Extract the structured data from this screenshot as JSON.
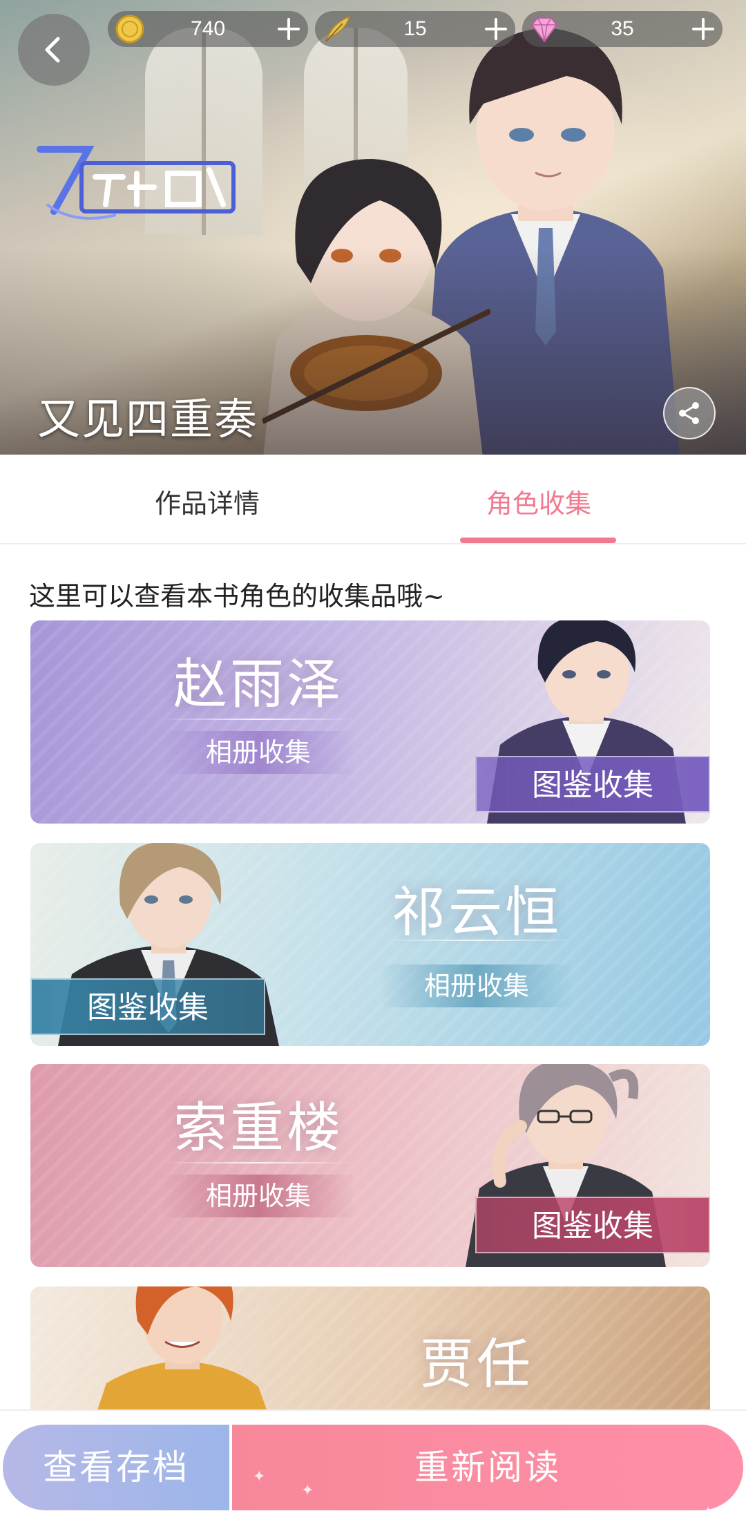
{
  "header": {
    "book_title": "又见四重奏",
    "logo_text": "又见四重奏",
    "currencies": [
      {
        "icon": "gold-coin-icon",
        "value": "740"
      },
      {
        "icon": "quill-feather-icon",
        "value": "15"
      },
      {
        "icon": "diamond-icon",
        "value": "35"
      }
    ]
  },
  "tabs": [
    {
      "label": "作品详情",
      "active": false
    },
    {
      "label": "角色收集",
      "active": true
    }
  ],
  "hint": "这里可以查看本书角色的收集品哦~",
  "characters": [
    {
      "name": "赵雨泽",
      "album_label": "相册收集",
      "codex_label": "图鉴收集"
    },
    {
      "name": "祁云恒",
      "album_label": "相册收集",
      "codex_label": "图鉴收集"
    },
    {
      "name": "索重楼",
      "album_label": "相册收集",
      "codex_label": "图鉴收集"
    },
    {
      "name": "贾任"
    }
  ],
  "bottom": {
    "archive_label": "查看存档",
    "reread_label": "重新阅读"
  },
  "colors": {
    "accent": "#f07a90",
    "card_purple": "#a796d8",
    "card_blue": "#96c9e3",
    "card_pink": "#dd9aab",
    "card_tan": "#c9a17c"
  }
}
